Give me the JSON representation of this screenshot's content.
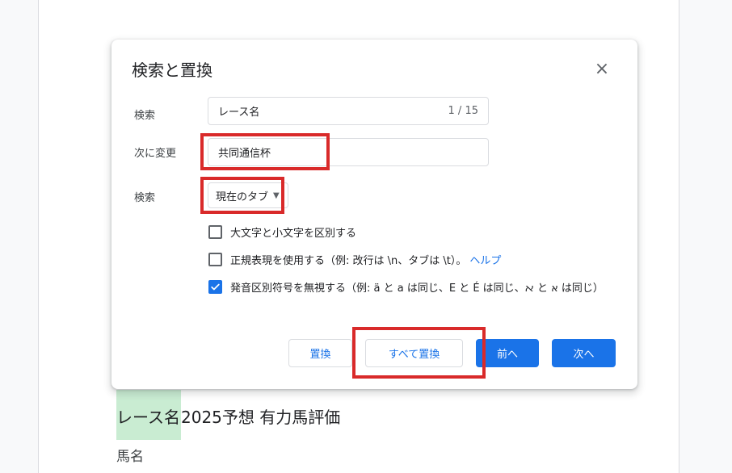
{
  "document": {
    "heading_highlight": "レース名",
    "heading_rest": "2025予想 有力馬評価",
    "paragraph": "馬名"
  },
  "dialog": {
    "title": "検索と置換",
    "close_icon": "close-icon",
    "find_label": "検索",
    "find_value": "レース名",
    "match_count": "1 / 15",
    "replace_label": "次に変更",
    "replace_value": "共同通信杯",
    "scope_label": "検索",
    "scope_value": "現在のタブ",
    "options": [
      {
        "label": "大文字と小文字を区別する",
        "checked": false
      },
      {
        "label": "正規表現を使用する（例: 改行は \\n、タブは \\t）。",
        "checked": false,
        "link": "ヘルプ"
      },
      {
        "label": "発音区別符号を無視する（例: ä と a は同じ、E と É は同じ、ﬡ と א は同じ）",
        "checked": true
      }
    ],
    "buttons": {
      "replace": "置換",
      "replace_all": "すべて置換",
      "prev": "前へ",
      "next": "次へ"
    }
  },
  "colors": {
    "accent": "#1a73e8",
    "annotation": "#d92a2a",
    "highlight": "#c9ecd2"
  }
}
